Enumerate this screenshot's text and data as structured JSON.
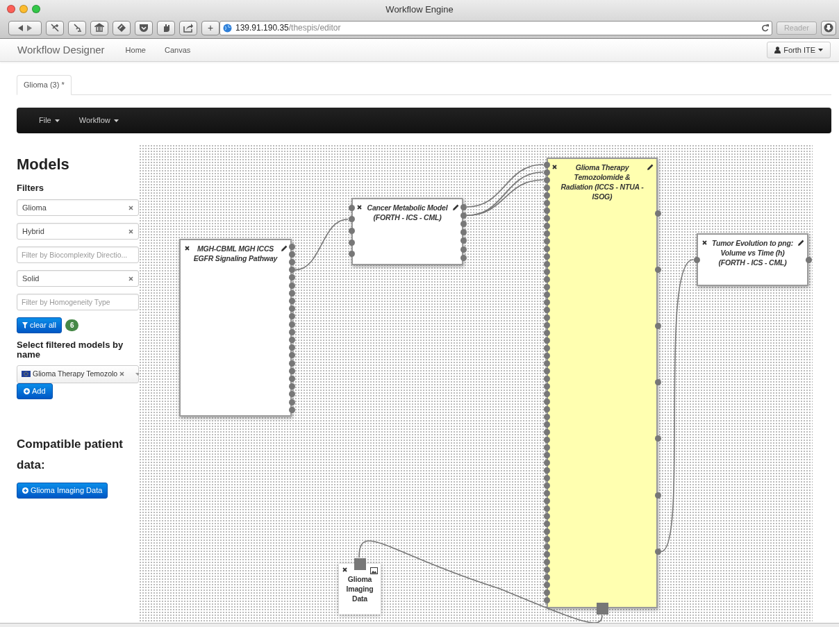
{
  "browser": {
    "title": "Workflow Engine",
    "new_tab_button": "+",
    "url_host": "139.91.190.35",
    "url_path": "/thespis/editor",
    "reader_button": "Reader"
  },
  "navbar": {
    "brand": "Workflow Designer",
    "links": [
      {
        "label": "Home"
      },
      {
        "label": "Canvas"
      }
    ],
    "user_menu": "Forth ITE"
  },
  "tabs": [
    {
      "label": "Glioma (3) *",
      "selected": true
    }
  ],
  "menubar": [
    {
      "label": "File"
    },
    {
      "label": "Workflow"
    }
  ],
  "sidebar": {
    "title": "Models",
    "filters_label": "Filters",
    "filters": [
      {
        "value": "Glioma"
      },
      {
        "value": "Hybrid"
      },
      {
        "placeholder": "Filter by Biocomplexity Directio..."
      },
      {
        "value": "Solid"
      },
      {
        "placeholder": "Filter by Homogeneity Type"
      }
    ],
    "clear_button": "clear all",
    "count_badge": "6",
    "select_label": "Select filtered models by name",
    "selected_model": "Glioma Therapy Temozolo",
    "add_button": "Add",
    "patient_data_title": "Compatible patient data:",
    "patient_data_buttons": [
      "Glioma Imaging Data"
    ]
  },
  "canvas": {
    "nodes": [
      {
        "kind": "model",
        "title": "MGH-CBML MGH ICCS EGFR Signaling Pathway",
        "selected": false
      },
      {
        "kind": "model",
        "title": "Cancer Metabolic Model (FORTH - ICS - CML)",
        "selected": false
      },
      {
        "kind": "model",
        "title": "Glioma Therapy Temozolomide & Radiation (ICCS - NTUA - ISOG)",
        "selected": true
      },
      {
        "kind": "model",
        "title": "Tumor Evolution to png: Volume vs Time (h) (FORTH - ICS - CML)",
        "selected": false
      },
      {
        "kind": "data",
        "title": "Glioma Imaging Data",
        "selected": false
      }
    ]
  }
}
